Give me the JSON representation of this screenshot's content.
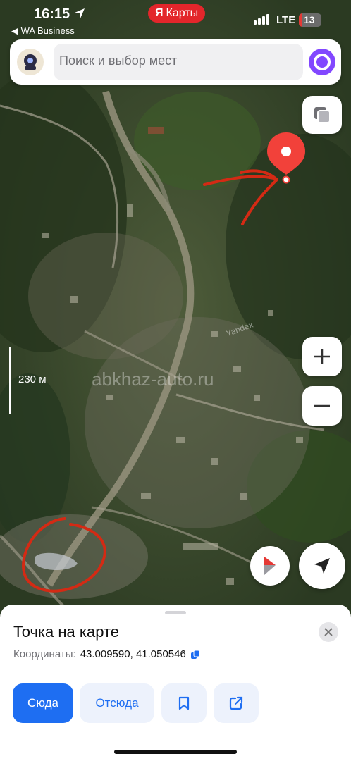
{
  "status_bar": {
    "time": "16:15",
    "back_label": "◀ WA Business",
    "app_badge": {
      "logo": "Я",
      "label": "Карты"
    },
    "network": "LTE",
    "battery": "13",
    "battery_level": 0.13
  },
  "search": {
    "placeholder": "Поиск и выбор мест",
    "avatar_icon": "avatar-icon",
    "assistant_icon": "alice-icon"
  },
  "map": {
    "watermark": "abkhaz-auto.ru",
    "provider_label": "Yandex",
    "scale_label": "230 м",
    "controls": [
      "layers-icon",
      "plus-icon",
      "minus-icon",
      "compass-icon",
      "location-arrow-icon"
    ]
  },
  "place_card": {
    "title": "Точка на карте",
    "coords_label": "Координаты:",
    "coords_value": "43.009590, 41.050546",
    "copy_icon": "copy-icon",
    "close_icon": "close-icon",
    "actions": {
      "to": "Сюда",
      "from": "Отсюда",
      "bookmark_icon": "bookmark-icon",
      "share_icon": "share-icon"
    }
  },
  "colors": {
    "accent": "#1e6ef2",
    "brand_red": "#e3262b",
    "marker": "#f2413a",
    "annotation": "#d42a14",
    "alice": "#8247ff"
  }
}
